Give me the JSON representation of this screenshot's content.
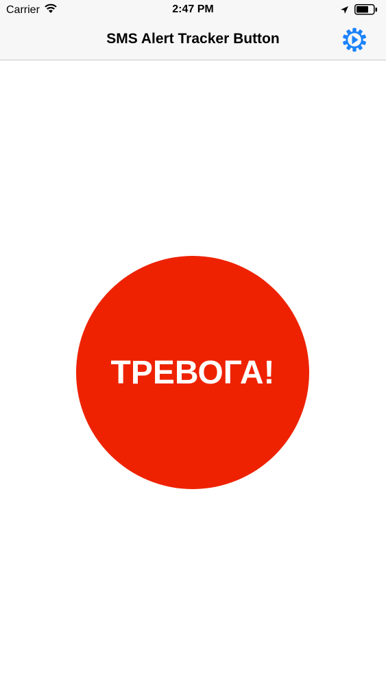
{
  "status_bar": {
    "carrier": "Carrier",
    "time": "2:47 PM",
    "icons": [
      "wifi-icon",
      "location-arrow-icon",
      "battery-icon"
    ]
  },
  "nav_bar": {
    "title": "SMS Alert Tracker Button",
    "settings_icon": "gear-icon"
  },
  "alarm_button": {
    "label": "ТРЕВОГА!"
  },
  "colors": {
    "accent": "#1a82fb",
    "alarm": "#ee2200",
    "bar_background": "#f7f7f7",
    "label": "#ffffff"
  }
}
